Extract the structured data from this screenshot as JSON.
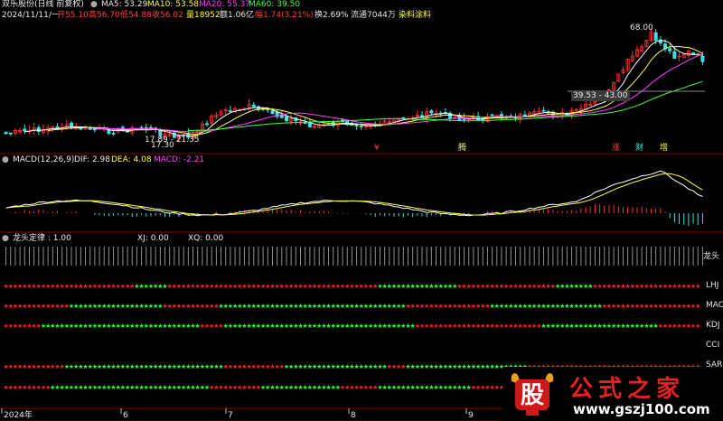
{
  "header": {
    "title": "双乐股份(日线 前复权)",
    "ma5": "MA5: 53.29",
    "ma10": "MA10: 53.58",
    "ma20": "MA20: 55.37",
    "ma60": "MA60: 39.50"
  },
  "quote": {
    "date": "2024/11/11/一",
    "open": "开55.10",
    "high": "高56.70",
    "low": "低54.88",
    "close": "收56.02",
    "volume": "量18952",
    "amount": "额1.06亿",
    "change": "幅1.74(3.21%)",
    "turnover": "换2.69%",
    "float": "流通7044万",
    "industry": "染料涂料"
  },
  "price_annotations": {
    "high_label": "68.00",
    "box_label": "39.53 - 43.00",
    "low_box_label": "17.89 - 21.35",
    "low_label": "17.30"
  },
  "event_markers": [
    "¥",
    "腾",
    "涨",
    "财",
    "增"
  ],
  "macd": {
    "title": "MACD(12,26,9)",
    "dif": "DIF: 2.98",
    "dea": "DEA: 4.08",
    "macd": "MACD: -2.21"
  },
  "dragon": {
    "title": "龙头定律 : 1.00",
    "xj": "XJ: 0.00",
    "xq": "XQ: 0.00",
    "side_label": "龙头"
  },
  "indicator_rows": [
    {
      "label": "LHJ"
    },
    {
      "label": "MAC"
    },
    {
      "label": "KDJ"
    },
    {
      "label": "CCI"
    },
    {
      "label": "SAR"
    },
    {
      "label": ""
    }
  ],
  "time_axis": [
    "2024年",
    "6",
    "7",
    "8",
    "9"
  ],
  "colors": {
    "up": "#ff3030",
    "down": "#40e0e0",
    "ma5": "#ffffff",
    "ma10": "#ffff40",
    "ma20": "#ff40ff",
    "ma60": "#40ff40",
    "star_red": "#ff2020",
    "star_green": "#30ff30"
  },
  "watermark": {
    "brand": "公式之家",
    "url": "www.gszj100.com",
    "glyph": "股"
  }
}
